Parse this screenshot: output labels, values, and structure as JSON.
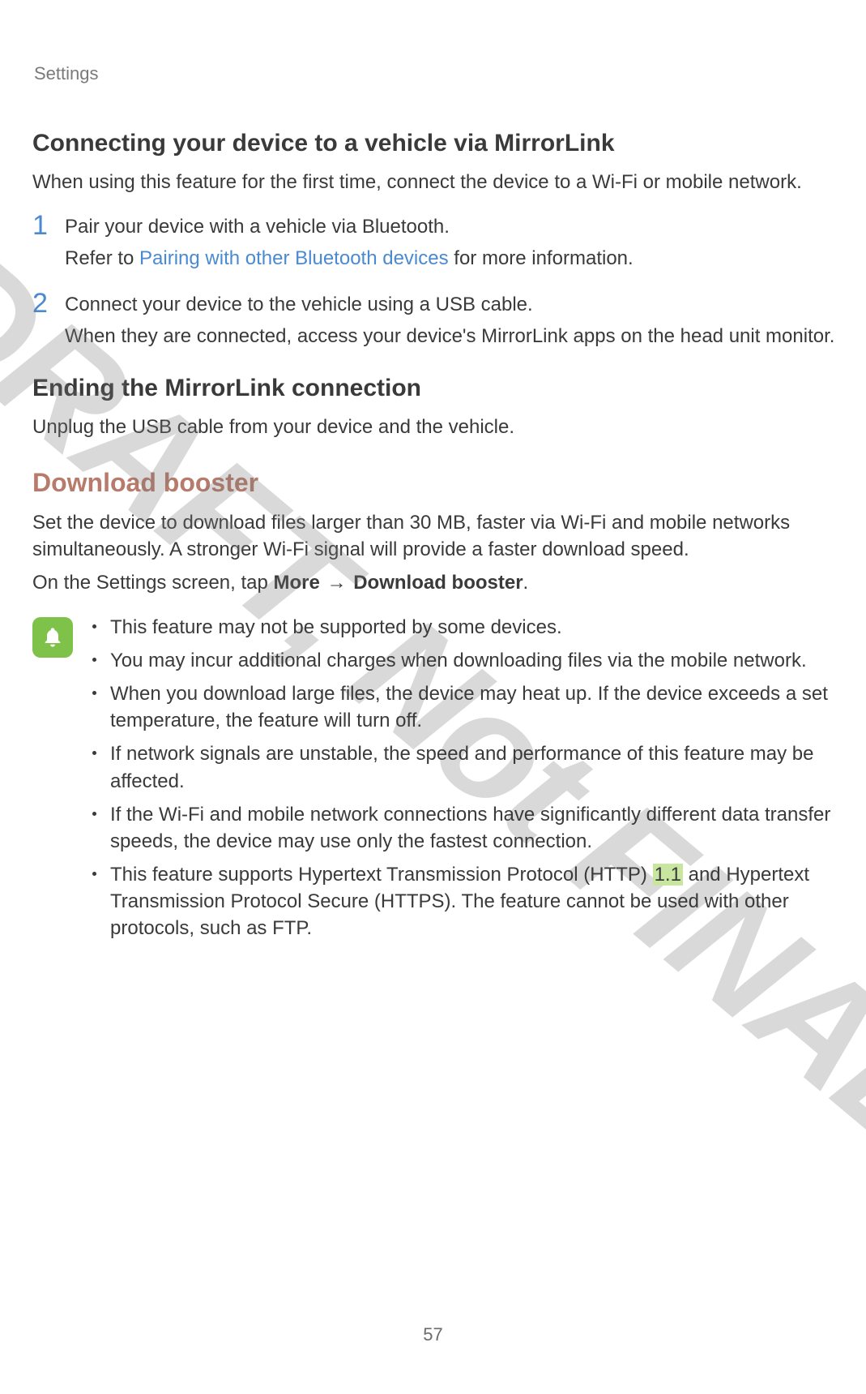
{
  "breadcrumb": "Settings",
  "watermark": "DRAFT, Not FINAL",
  "page_number": "57",
  "section1": {
    "heading": "Connecting your device to a vehicle via MirrorLink",
    "intro": "When using this feature for the first time, connect the device to a Wi-Fi or mobile network.",
    "steps": [
      {
        "num": "1",
        "line1": "Pair your device with a vehicle via Bluetooth.",
        "line2_prefix": "Refer to ",
        "line2_link": "Pairing with other Bluetooth devices",
        "line2_suffix": " for more information."
      },
      {
        "num": "2",
        "line1": "Connect your device to the vehicle using a USB cable.",
        "line2": "When they are connected, access your device's MirrorLink apps on the head unit monitor."
      }
    ]
  },
  "section2": {
    "heading": "Ending the MirrorLink connection",
    "body": "Unplug the USB cable from your device and the vehicle."
  },
  "section3": {
    "heading": "Download booster",
    "body1": "Set the device to download files larger than 30 MB, faster via Wi-Fi and mobile networks simultaneously. A stronger Wi-Fi signal will provide a faster download speed.",
    "body2_prefix": "On the Settings screen, tap ",
    "body2_path_a": "More",
    "body2_arrow": "→",
    "body2_path_b": "Download booster",
    "body2_suffix": ".",
    "notes": [
      "This feature may not be supported by some devices.",
      "You may incur additional charges when downloading files via the mobile network.",
      "When you download large files, the device may heat up. If the device exceeds a set temperature, the feature will turn off.",
      "If network signals are unstable, the speed and performance of this feature may be affected.",
      "If the Wi-Fi and mobile network connections have significantly different data transfer speeds, the device may use only the fastest connection."
    ],
    "note_last_prefix": "This feature supports Hypertext Transmission Protocol (HTTP) ",
    "note_last_hl": "1.1",
    "note_last_suffix": " and Hypertext Transmission Protocol Secure (HTTPS). The feature cannot be used with other protocols, such as FTP."
  }
}
